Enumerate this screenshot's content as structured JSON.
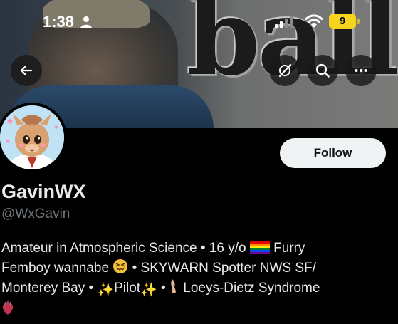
{
  "status_bar": {
    "time": "1:38",
    "battery": "9"
  },
  "banner": {
    "word": "balls"
  },
  "profile": {
    "follow_label": "Follow",
    "display_name": "GavinWX",
    "handle": "@WxGavin",
    "bio": {
      "line1_text": "Amateur in Atmospheric Science • 16 y/o",
      "line1_after": "Furry",
      "line2_text": "Femboy wannabe",
      "line2_after": "• SKYWARN Spotter NWS SF/",
      "line3_text": "Monterey Bay •",
      "line3_pilot": "Pilot",
      "line3_sep": "•",
      "line3_after": "Loeys-Dietz Syndrome"
    }
  },
  "icons": {
    "back": "arrow-left-icon",
    "grok": "grok-icon",
    "search": "search-icon",
    "more": "more-horizontal-icon",
    "flag": "rainbow-flag-icon",
    "face": "confounded-face-icon",
    "sparkles": "sparkles-icon",
    "leg": "leg-icon",
    "heart": "anatomical-heart-icon"
  },
  "colors": {
    "background": "#000000",
    "text": "#e7e9ea",
    "muted": "#71767b",
    "follow_bg": "#eff3f4",
    "battery": "#f6d31c"
  }
}
